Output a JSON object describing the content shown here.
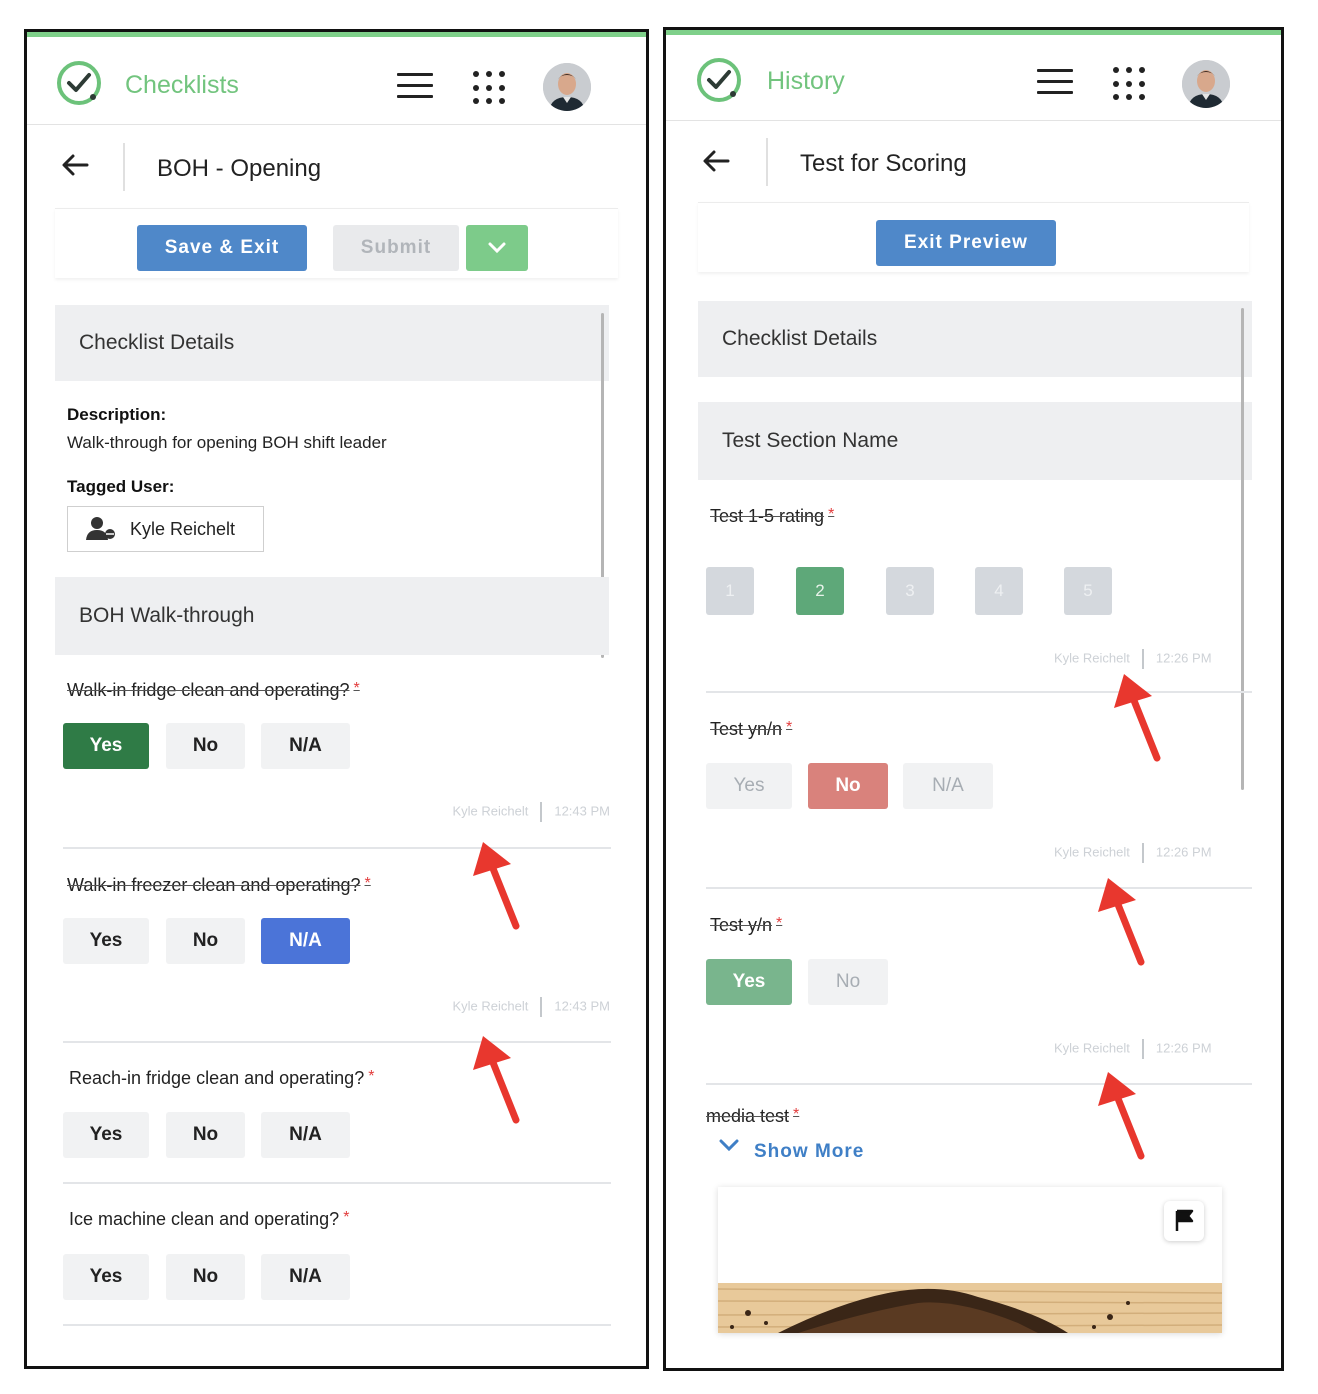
{
  "left": {
    "app_title": "Checklists",
    "page_title": "BOH - Opening",
    "buttons": {
      "save_exit": "Save & Exit",
      "submit": "Submit"
    },
    "details_heading": "Checklist Details",
    "description_label": "Description:",
    "description_text": "Walk-through for opening BOH shift leader",
    "tagged_user_label": "Tagged User:",
    "tagged_user": "Kyle Reichelt",
    "section_heading": "BOH Walk-through",
    "questions": [
      {
        "text": "Walk-in fridge clean and operating?",
        "req": "*",
        "options": [
          "Yes",
          "No",
          "N/A"
        ],
        "selected": "Yes",
        "meta_user": "Kyle Reichelt",
        "meta_time": "12:43 PM"
      },
      {
        "text": "Walk-in freezer clean and operating?",
        "req": "*",
        "options": [
          "Yes",
          "No",
          "N/A"
        ],
        "selected": "N/A",
        "meta_user": "Kyle Reichelt",
        "meta_time": "12:43 PM"
      },
      {
        "text": "Reach-in fridge clean and operating?",
        "req": "*",
        "options": [
          "Yes",
          "No",
          "N/A"
        ],
        "selected": ""
      },
      {
        "text": "Ice machine clean and operating?",
        "req": "*",
        "options": [
          "Yes",
          "No",
          "N/A"
        ],
        "selected": ""
      }
    ]
  },
  "right": {
    "app_title": "History",
    "page_title": "Test for Scoring",
    "buttons": {
      "exit_preview": "Exit Preview"
    },
    "details_heading": "Checklist Details",
    "section_heading": "Test Section Name",
    "rating_question": {
      "text": "Test 1-5 rating",
      "req": "*",
      "options": [
        "1",
        "2",
        "3",
        "4",
        "5"
      ],
      "selected": "2",
      "meta_user": "Kyle Reichelt",
      "meta_time": "12:26 PM"
    },
    "yn_na_question": {
      "text": "Test yn/n",
      "req": "*",
      "options": [
        "Yes",
        "No",
        "N/A"
      ],
      "selected": "No",
      "meta_user": "Kyle Reichelt",
      "meta_time": "12:26 PM"
    },
    "yn_question": {
      "text": "Test y/n",
      "req": "*",
      "options": [
        "Yes",
        "No"
      ],
      "selected": "Yes",
      "meta_user": "Kyle Reichelt",
      "meta_time": "12:26 PM"
    },
    "media_question": {
      "text": "media test",
      "req": "*"
    },
    "show_more": "Show More"
  },
  "colors": {
    "brand_green": "#72c47e",
    "primary_blue": "#4f88c9",
    "selected_dark_green": "#2f7b46",
    "selected_blue": "#4b74d8",
    "selected_red": "#d9827c",
    "required_red": "#e23c3c",
    "annotation_arrow": "#e8372e"
  },
  "icons": [
    "check-circle-logo",
    "hamburger-menu-icon",
    "apps-grid-icon",
    "avatar",
    "back-arrow-icon",
    "chevron-down-icon",
    "user-icon",
    "flag-icon"
  ]
}
